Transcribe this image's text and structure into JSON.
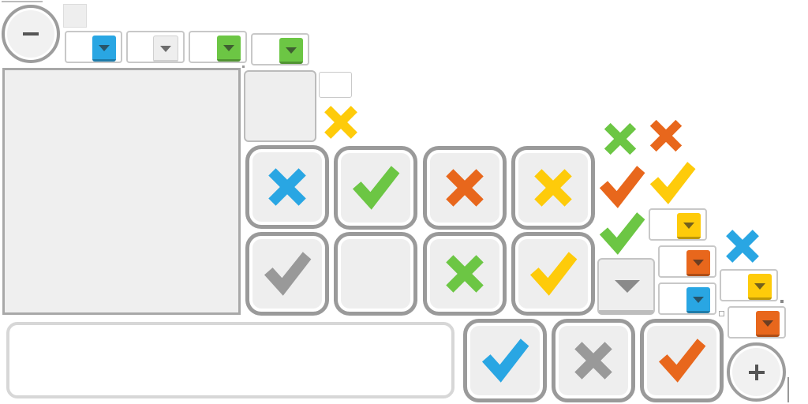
{
  "colors": {
    "blue": "#29a6e3",
    "green": "#6cc644",
    "orange": "#e8671c",
    "yellow": "#fecb0a",
    "gray": "#999999",
    "light": "#eeeeee"
  },
  "zoom": {
    "minus_icon": "minus-icon",
    "plus_icon": "plus-icon"
  },
  "dropdowns": [
    {
      "name": "dropdown-blue",
      "color": "blue"
    },
    {
      "name": "dropdown-gray",
      "color": "light"
    },
    {
      "name": "dropdown-green",
      "color": "green"
    },
    {
      "name": "dropdown-green-2",
      "color": "green"
    },
    {
      "name": "dropdown-yellow",
      "color": "yellow"
    },
    {
      "name": "dropdown-orange",
      "color": "orange"
    },
    {
      "name": "dropdown-blue-2",
      "color": "blue"
    },
    {
      "name": "dropdown-yellow-2",
      "color": "yellow"
    },
    {
      "name": "dropdown-orange-2",
      "color": "orange"
    }
  ],
  "tiles": [
    {
      "icon": "cross",
      "color": "blue"
    },
    {
      "icon": "check",
      "color": "green"
    },
    {
      "icon": "cross",
      "color": "orange"
    },
    {
      "icon": "cross",
      "color": "yellow"
    },
    {
      "icon": "check",
      "color": "gray"
    },
    {
      "icon": "none",
      "color": "light"
    },
    {
      "icon": "cross",
      "color": "green"
    },
    {
      "icon": "check",
      "color": "yellow"
    },
    {
      "icon": "check",
      "color": "blue"
    },
    {
      "icon": "cross",
      "color": "gray"
    },
    {
      "icon": "check",
      "color": "orange"
    }
  ],
  "free_marks": [
    {
      "icon": "cross",
      "color": "yellow"
    },
    {
      "icon": "cross",
      "color": "green"
    },
    {
      "icon": "cross",
      "color": "orange"
    },
    {
      "icon": "check",
      "color": "orange"
    },
    {
      "icon": "check",
      "color": "yellow"
    },
    {
      "icon": "check",
      "color": "green"
    },
    {
      "icon": "cross",
      "color": "blue"
    }
  ]
}
